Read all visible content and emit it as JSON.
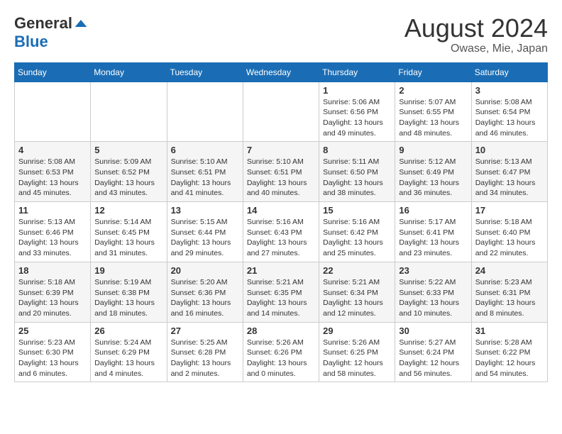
{
  "header": {
    "logo_general": "General",
    "logo_blue": "Blue",
    "month_title": "August 2024",
    "location": "Owase, Mie, Japan"
  },
  "weekdays": [
    "Sunday",
    "Monday",
    "Tuesday",
    "Wednesday",
    "Thursday",
    "Friday",
    "Saturday"
  ],
  "weeks": [
    [
      {
        "day": "",
        "info": ""
      },
      {
        "day": "",
        "info": ""
      },
      {
        "day": "",
        "info": ""
      },
      {
        "day": "",
        "info": ""
      },
      {
        "day": "1",
        "info": "Sunrise: 5:06 AM\nSunset: 6:56 PM\nDaylight: 13 hours\nand 49 minutes."
      },
      {
        "day": "2",
        "info": "Sunrise: 5:07 AM\nSunset: 6:55 PM\nDaylight: 13 hours\nand 48 minutes."
      },
      {
        "day": "3",
        "info": "Sunrise: 5:08 AM\nSunset: 6:54 PM\nDaylight: 13 hours\nand 46 minutes."
      }
    ],
    [
      {
        "day": "4",
        "info": "Sunrise: 5:08 AM\nSunset: 6:53 PM\nDaylight: 13 hours\nand 45 minutes."
      },
      {
        "day": "5",
        "info": "Sunrise: 5:09 AM\nSunset: 6:52 PM\nDaylight: 13 hours\nand 43 minutes."
      },
      {
        "day": "6",
        "info": "Sunrise: 5:10 AM\nSunset: 6:51 PM\nDaylight: 13 hours\nand 41 minutes."
      },
      {
        "day": "7",
        "info": "Sunrise: 5:10 AM\nSunset: 6:51 PM\nDaylight: 13 hours\nand 40 minutes."
      },
      {
        "day": "8",
        "info": "Sunrise: 5:11 AM\nSunset: 6:50 PM\nDaylight: 13 hours\nand 38 minutes."
      },
      {
        "day": "9",
        "info": "Sunrise: 5:12 AM\nSunset: 6:49 PM\nDaylight: 13 hours\nand 36 minutes."
      },
      {
        "day": "10",
        "info": "Sunrise: 5:13 AM\nSunset: 6:47 PM\nDaylight: 13 hours\nand 34 minutes."
      }
    ],
    [
      {
        "day": "11",
        "info": "Sunrise: 5:13 AM\nSunset: 6:46 PM\nDaylight: 13 hours\nand 33 minutes."
      },
      {
        "day": "12",
        "info": "Sunrise: 5:14 AM\nSunset: 6:45 PM\nDaylight: 13 hours\nand 31 minutes."
      },
      {
        "day": "13",
        "info": "Sunrise: 5:15 AM\nSunset: 6:44 PM\nDaylight: 13 hours\nand 29 minutes."
      },
      {
        "day": "14",
        "info": "Sunrise: 5:16 AM\nSunset: 6:43 PM\nDaylight: 13 hours\nand 27 minutes."
      },
      {
        "day": "15",
        "info": "Sunrise: 5:16 AM\nSunset: 6:42 PM\nDaylight: 13 hours\nand 25 minutes."
      },
      {
        "day": "16",
        "info": "Sunrise: 5:17 AM\nSunset: 6:41 PM\nDaylight: 13 hours\nand 23 minutes."
      },
      {
        "day": "17",
        "info": "Sunrise: 5:18 AM\nSunset: 6:40 PM\nDaylight: 13 hours\nand 22 minutes."
      }
    ],
    [
      {
        "day": "18",
        "info": "Sunrise: 5:18 AM\nSunset: 6:39 PM\nDaylight: 13 hours\nand 20 minutes."
      },
      {
        "day": "19",
        "info": "Sunrise: 5:19 AM\nSunset: 6:38 PM\nDaylight: 13 hours\nand 18 minutes."
      },
      {
        "day": "20",
        "info": "Sunrise: 5:20 AM\nSunset: 6:36 PM\nDaylight: 13 hours\nand 16 minutes."
      },
      {
        "day": "21",
        "info": "Sunrise: 5:21 AM\nSunset: 6:35 PM\nDaylight: 13 hours\nand 14 minutes."
      },
      {
        "day": "22",
        "info": "Sunrise: 5:21 AM\nSunset: 6:34 PM\nDaylight: 13 hours\nand 12 minutes."
      },
      {
        "day": "23",
        "info": "Sunrise: 5:22 AM\nSunset: 6:33 PM\nDaylight: 13 hours\nand 10 minutes."
      },
      {
        "day": "24",
        "info": "Sunrise: 5:23 AM\nSunset: 6:31 PM\nDaylight: 13 hours\nand 8 minutes."
      }
    ],
    [
      {
        "day": "25",
        "info": "Sunrise: 5:23 AM\nSunset: 6:30 PM\nDaylight: 13 hours\nand 6 minutes."
      },
      {
        "day": "26",
        "info": "Sunrise: 5:24 AM\nSunset: 6:29 PM\nDaylight: 13 hours\nand 4 minutes."
      },
      {
        "day": "27",
        "info": "Sunrise: 5:25 AM\nSunset: 6:28 PM\nDaylight: 13 hours\nand 2 minutes."
      },
      {
        "day": "28",
        "info": "Sunrise: 5:26 AM\nSunset: 6:26 PM\nDaylight: 13 hours\nand 0 minutes."
      },
      {
        "day": "29",
        "info": "Sunrise: 5:26 AM\nSunset: 6:25 PM\nDaylight: 12 hours\nand 58 minutes."
      },
      {
        "day": "30",
        "info": "Sunrise: 5:27 AM\nSunset: 6:24 PM\nDaylight: 12 hours\nand 56 minutes."
      },
      {
        "day": "31",
        "info": "Sunrise: 5:28 AM\nSunset: 6:22 PM\nDaylight: 12 hours\nand 54 minutes."
      }
    ]
  ]
}
